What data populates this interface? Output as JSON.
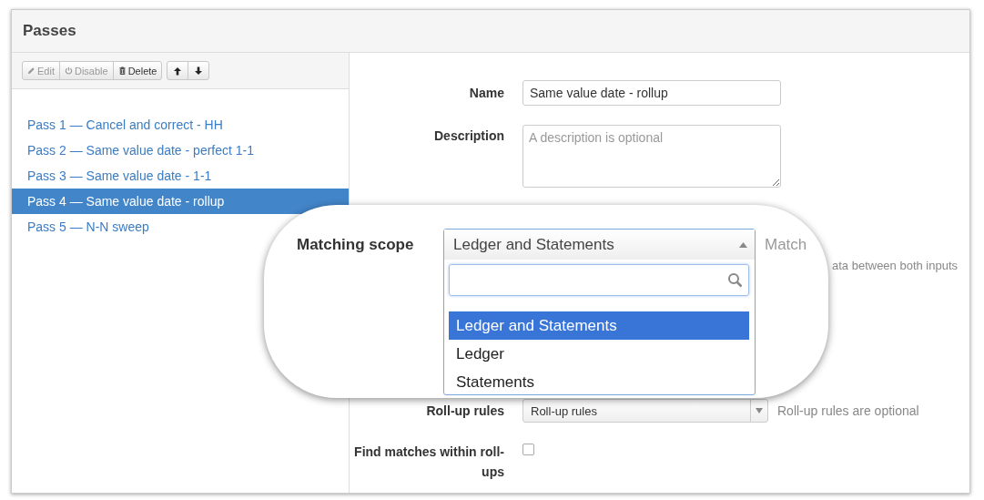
{
  "panel": {
    "title": "Passes"
  },
  "toolbar": [
    {
      "label": "Edit",
      "kind": "edit",
      "disabled": true
    },
    {
      "label": "Disable",
      "kind": "disable",
      "disabled": true
    },
    {
      "label": "Delete",
      "kind": "delete",
      "disabled": false
    }
  ],
  "move_buttons": [
    {
      "kind": "up"
    },
    {
      "kind": "down"
    }
  ],
  "passes": [
    {
      "label": "Pass 1 — Cancel and correct - HH",
      "selected": false
    },
    {
      "label": "Pass 2 — Same value date - perfect 1-1",
      "selected": false
    },
    {
      "label": "Pass 3 — Same value date - 1-1",
      "selected": false
    },
    {
      "label": "Pass 4 — Same value date - rollup",
      "selected": true
    },
    {
      "label": "Pass 5 — N-N sweep",
      "selected": false
    }
  ],
  "form": {
    "name": {
      "label": "Name",
      "value": "Same value date - rollup"
    },
    "description": {
      "label": "Description",
      "placeholder": "A description is optional"
    },
    "scope_help_tail": "ata between both inputs",
    "rollup": {
      "label": "Roll-up rules",
      "value": "Roll-up rules",
      "help": "Roll-up rules are optional"
    },
    "find_within": {
      "label": "Find matches within roll-ups",
      "checked": false
    }
  },
  "callout": {
    "label": "Matching scope",
    "value": "Ledger and Statements",
    "help": "Match",
    "options": [
      {
        "label": "Ledger and Statements",
        "selected": true
      },
      {
        "label": "Ledger",
        "selected": false
      },
      {
        "label": "Statements",
        "selected": false
      }
    ]
  }
}
